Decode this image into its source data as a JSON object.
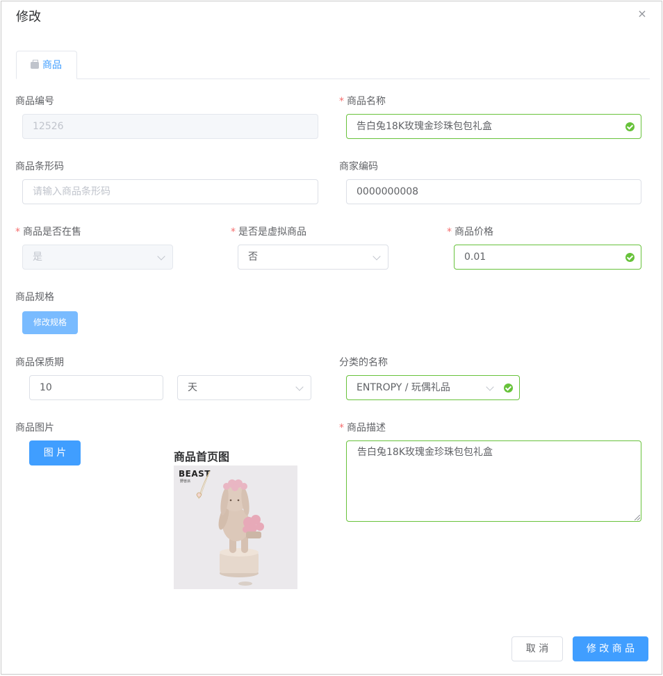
{
  "dialog": {
    "title": "修改",
    "close_symbol": "×"
  },
  "tabs": [
    {
      "label": "商品"
    }
  ],
  "fields": {
    "product_no": {
      "label": "商品编号",
      "value": "12526"
    },
    "product_name": {
      "label": "商品名称",
      "required": "*",
      "value": "告白兔18K玫瑰金珍珠包包礼盒"
    },
    "barcode": {
      "label": "商品条形码",
      "placeholder": "请输入商品条形码"
    },
    "merchant_code": {
      "label": "商家编码",
      "value": "0000000008"
    },
    "on_sale": {
      "label": "商品是否在售",
      "required": "*",
      "value": "是"
    },
    "virtual": {
      "label": "是否是虚拟商品",
      "required": "*",
      "value": "否"
    },
    "price": {
      "label": "商品价格",
      "required": "*",
      "value": "0.01"
    },
    "spec": {
      "label": "商品规格",
      "button": "修改规格"
    },
    "shelf_life": {
      "label": "商品保质期",
      "value": "10",
      "unit": "天"
    },
    "category": {
      "label": "分类的名称",
      "value": "ENTROPY / 玩偶礼品"
    },
    "image": {
      "label": "商品图片",
      "button": "图 片",
      "home_title": "商品首页图",
      "logo_text": "BEAST",
      "logo_sub": "野兽派"
    },
    "description": {
      "label": "商品描述",
      "required": "*",
      "value": "告白兔18K玫瑰金珍珠包包礼盒"
    }
  },
  "footer": {
    "cancel": "取 消",
    "submit": "修 改 商 品"
  },
  "colors": {
    "primary": "#409eff",
    "success": "#67c23a",
    "required": "#f56c6c"
  }
}
